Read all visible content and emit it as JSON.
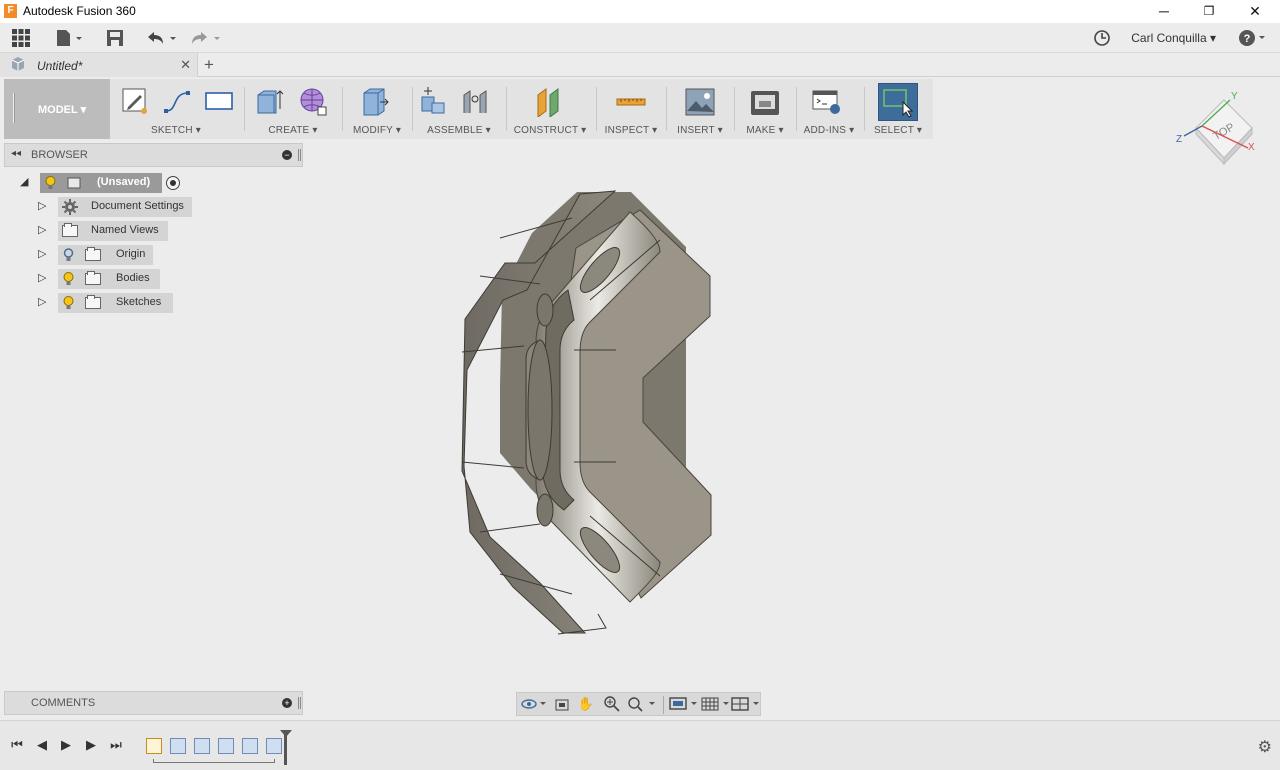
{
  "window": {
    "app_title": "Autodesk Fusion 360",
    "minimize": "─",
    "restore": "❐",
    "close": "✕"
  },
  "user": {
    "name": "Carl Conquilla"
  },
  "tabs": [
    {
      "label": "Untitled*",
      "active": true
    }
  ],
  "ribbon": {
    "workspace": "MODEL",
    "groups": [
      {
        "label": "SKETCH"
      },
      {
        "label": "CREATE"
      },
      {
        "label": "MODIFY"
      },
      {
        "label": "ASSEMBLE"
      },
      {
        "label": "CONSTRUCT"
      },
      {
        "label": "INSPECT"
      },
      {
        "label": "INSERT"
      },
      {
        "label": "MAKE"
      },
      {
        "label": "ADD-INS"
      },
      {
        "label": "SELECT"
      }
    ]
  },
  "viewcube": {
    "face": "TOP",
    "axes": [
      "X",
      "Y",
      "Z"
    ]
  },
  "browser": {
    "title": "BROWSER",
    "root": "(Unsaved)",
    "items": [
      {
        "label": "Document Settings"
      },
      {
        "label": "Named Views"
      },
      {
        "label": "Origin"
      },
      {
        "label": "Bodies"
      },
      {
        "label": "Sketches"
      }
    ]
  },
  "comments": {
    "title": "COMMENTS"
  },
  "colors": {
    "ribbon_bg": "#e3e3e3",
    "select_active": "#3e6d9c",
    "model_body": "#9a9588",
    "bulb": "#f5c518"
  }
}
